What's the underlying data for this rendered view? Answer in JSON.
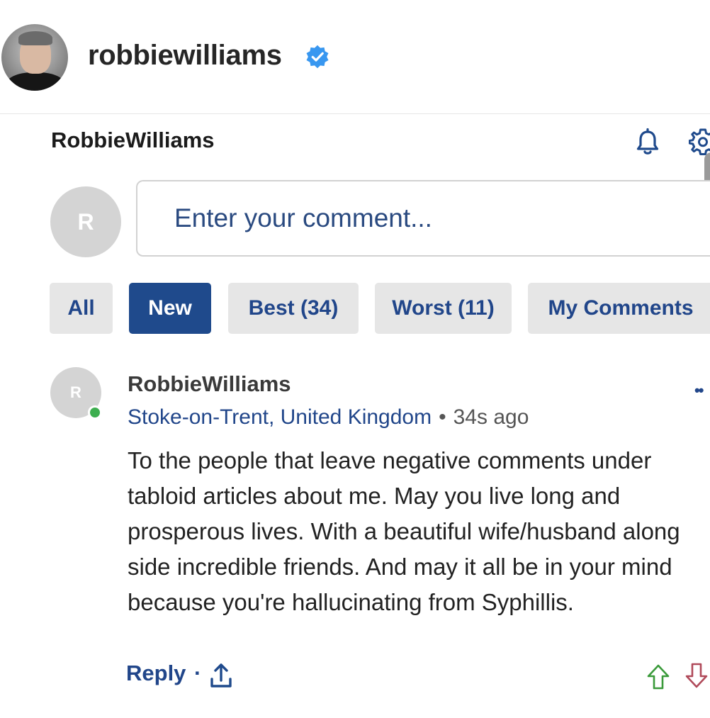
{
  "post": {
    "username": "robbiewilliams",
    "verified": true
  },
  "widget": {
    "title": "RobbieWilliams",
    "input_avatar_letter": "R",
    "input_placeholder": "Enter your comment...",
    "tabs": [
      {
        "label": "All",
        "active": false
      },
      {
        "label": "New",
        "active": true
      },
      {
        "label": "Best (34)",
        "active": false
      },
      {
        "label": "Worst (11)",
        "active": false
      },
      {
        "label": "My Comments",
        "active": false
      }
    ]
  },
  "comment": {
    "avatar_letter": "R",
    "author": "RobbieWilliams",
    "location": "Stoke-on-Trent, United Kingdom",
    "separator": "•",
    "time": "34s ago",
    "body": "To the people that leave negative comments under tabloid articles about me. May you live long and prosperous lives. With a beautiful wife/husband along side incredible friends. And may it all be in your mind because you're hallucinating from Syphillis.",
    "reply_label": "Reply",
    "reply_separator": "·"
  },
  "colors": {
    "accent": "#1f4a8c",
    "tab_bg": "#e6e6e6",
    "online": "#3dae4f",
    "upvote": "#3a9a3a",
    "downvote": "#b04a5a",
    "verified": "#3897f0"
  },
  "icons": [
    "verified-badge-icon",
    "bell-icon",
    "gear-icon",
    "more-icon",
    "share-icon",
    "upvote-icon",
    "downvote-icon"
  ]
}
